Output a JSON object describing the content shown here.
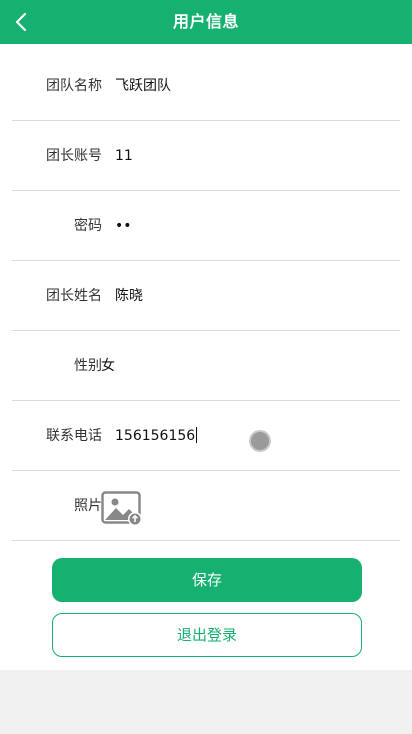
{
  "header": {
    "title": "用户信息",
    "back_icon": "chevron-left-icon"
  },
  "form": {
    "team_name": {
      "label": "团队名称",
      "value": "飞跃团队"
    },
    "leader_account": {
      "label": "团长账号",
      "value": "11"
    },
    "password": {
      "label": "密码",
      "value": "••"
    },
    "leader_name": {
      "label": "团长姓名",
      "value": "陈晓"
    },
    "gender": {
      "label": "性别",
      "value": "女"
    },
    "phone": {
      "label": "联系电话",
      "value": "156156156"
    },
    "photo": {
      "label": "照片",
      "icon": "image-upload-icon"
    }
  },
  "actions": {
    "save_label": "保存",
    "logout_label": "退出登录"
  },
  "colors": {
    "accent": "#16b070",
    "background": "#f0f0f0"
  }
}
